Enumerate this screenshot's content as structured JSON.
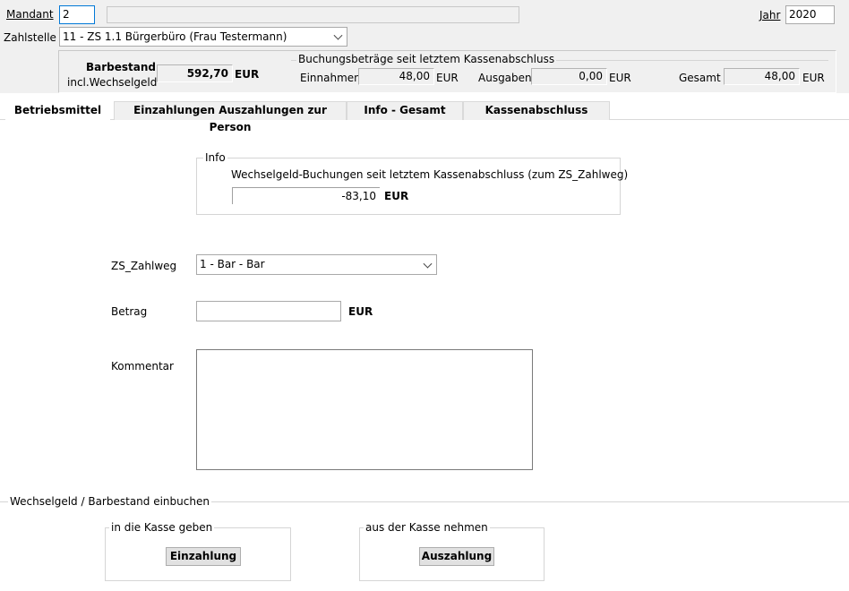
{
  "header": {
    "mandant_label": "Mandant",
    "mandant_value": "2",
    "mandant_name": "",
    "jahr_label": "Jahr",
    "jahr_value": "2020",
    "zahlstelle_label": "Zahlstelle",
    "zahlstelle_value": "11 - ZS 1.1 Bürgerbüro (Frau Testermann)"
  },
  "summary": {
    "barbestand_label": "Barbestand",
    "wechselgeld_label": "incl.Wechselgeld",
    "barbestand_value": "592,70",
    "barbestand_unit": "EUR",
    "buchung_title": "Buchungsbeträge seit letztem Kassenabschluss",
    "einnahmen_label": "Einnahmen",
    "einnahmen_value": "48,00",
    "einnahmen_unit": "EUR",
    "ausgaben_label": "Ausgaben",
    "ausgaben_value": "0,00",
    "ausgaben_unit": "EUR",
    "gesamt_label": "Gesamt",
    "gesamt_value": "48,00",
    "gesamt_unit": "EUR"
  },
  "tabs": [
    {
      "label": "Betriebsmittel",
      "active": true
    },
    {
      "label": "Einzahlungen Auszahlungen zur Person",
      "active": false
    },
    {
      "label": "Info - Gesamt",
      "active": false
    },
    {
      "label": "Kassenabschluss",
      "active": false
    }
  ],
  "info": {
    "title": "Info",
    "text": "Wechselgeld-Buchungen seit letztem Kassenabschluss  (zum ZS_Zahlweg)",
    "value": "-83,10",
    "unit": "EUR"
  },
  "form": {
    "zahlweg_label": "ZS_Zahlweg",
    "zahlweg_value": "1 - Bar - Bar",
    "betrag_label": "Betrag",
    "betrag_value": "",
    "betrag_unit": "EUR",
    "kommentar_label": "Kommentar",
    "kommentar_value": ""
  },
  "einbuchen": {
    "title": "Wechselgeld / Barbestand einbuchen",
    "in_title": "in die Kasse geben",
    "in_button": "Einzahlung",
    "out_title": "aus der Kasse nehmen",
    "out_button": "Auszahlung"
  }
}
